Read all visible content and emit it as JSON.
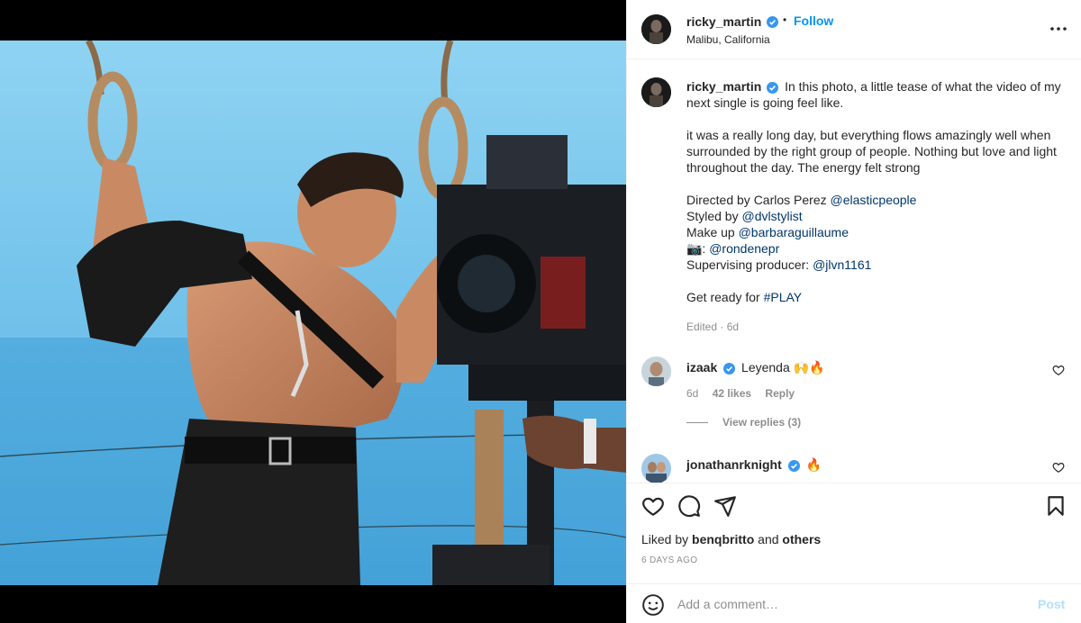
{
  "post": {
    "author": "ricky_martin",
    "verified": true,
    "follow_label": "Follow",
    "dot": "•",
    "location": "Malibu, California"
  },
  "caption": {
    "author": "ricky_martin",
    "line1": "In this photo, a little tease of what the video of my next single is going feel like.",
    "para2": "it was a really long day, but everything flows amazingly well when surrounded by the right group of people. Nothing but love and light throughout the day. The energy felt strong",
    "credits": [
      {
        "prefix": "Directed by Carlos Perez ",
        "mention": "@elasticpeople"
      },
      {
        "prefix": "Styled by ",
        "mention": "@dvlstylist"
      },
      {
        "prefix": "Make up ",
        "mention": "@barbaraguillaume"
      },
      {
        "prefix": "📷: ",
        "mention": "@rondenepr"
      },
      {
        "prefix": "Supervising producer: ",
        "mention": "@jlvn1161"
      }
    ],
    "closing_prefix": "Get ready for ",
    "closing_tag": "#PLAY",
    "edited": "Edited · 6d"
  },
  "comments": [
    {
      "user": "izaak",
      "text": "Leyenda 🙌🔥",
      "age": "6d",
      "likes": "42 likes",
      "reply": "Reply",
      "view_replies": "View replies (3)"
    },
    {
      "user": "jonathanrknight",
      "text": "🔥"
    }
  ],
  "actions": {
    "liked_by_prefix": "Liked by ",
    "liked_by_user": "benqbritto",
    "liked_by_and": " and ",
    "liked_by_others": "others",
    "timestamp": "6 DAYS AGO"
  },
  "add_comment": {
    "placeholder": "Add a comment…",
    "post_label": "Post"
  },
  "icons": {
    "verified": "verified-badge-icon",
    "more": "more-options-icon",
    "like": "heart-icon",
    "comment": "comment-icon",
    "share": "share-icon",
    "save": "bookmark-icon",
    "emoji": "emoji-icon"
  },
  "colors": {
    "accent": "#0095f6",
    "mention": "#00376b",
    "muted": "#8e8e8e",
    "post_disabled": "#b2dffc"
  }
}
